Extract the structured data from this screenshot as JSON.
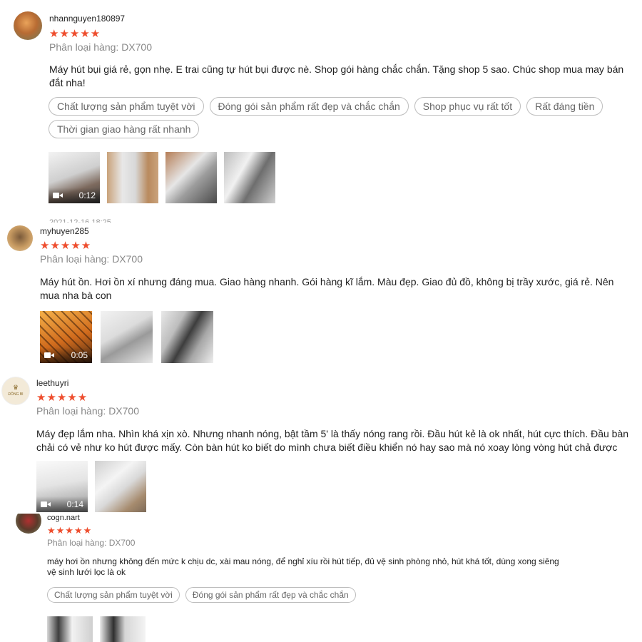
{
  "reviews": [
    {
      "username": "nhannguyen180897",
      "stars": "★★★★★",
      "variant": "Phân loại hàng: DX700",
      "text": "Máy hút bụi giá rẻ, gọn nhẹ. E trai cũng tự hút bụi được nè. Shop gói hàng chắc chắn. Tặng shop 5 sao. Chúc shop mua may bán đắt nha!",
      "tags": [
        "Chất lượng sản phẩm tuyệt vời",
        "Đóng gói sản phẩm rất đẹp và chắc chắn",
        "Shop phục vụ rất tốt",
        "Rất đáng tiền",
        "Thời gian giao hàng rất nhanh"
      ],
      "video_duration": "0:12",
      "date": "2021-12-16 18:25"
    },
    {
      "username": "myhuyen285",
      "stars": "★★★★★",
      "variant": "Phân loại hàng: DX700",
      "text": "Máy hút ồn. Hơi ồn xí nhưng đáng mua. Giao hàng nhanh. Gói hàng kĩ lắm. Màu đẹp. Giao đủ đồ, không bị trầy xước, giá rẻ. Nên mua nha bà con",
      "video_duration": "0:05"
    },
    {
      "username": "leethuyri",
      "stars": "★★★★★",
      "variant": "Phân loại hàng: DX700",
      "text": "Máy đẹp lắm nha. Nhìn khá xịn xò. Nhưng nhanh nóng, bật tầm 5' là thấy nóng rang rồi. Đầu hút kẻ là ok nhất, hút cực thích. Đầu bàn chải có vẻ như ko hút được mấy. Còn bàn hút ko biết do mình chưa biết điều khiển nó hay sao mà nó xoay lòng vòng hút chả được",
      "video_duration": "0:14",
      "avatar_text": "ĐÔNG BI"
    },
    {
      "username": "cogn.nart",
      "stars": "★★★★★",
      "variant": "Phân loại hàng: DX700",
      "text": "máy hơi ồn nhưng không đến mức k chịu dc, xài mau nóng, để nghỉ xíu rồi hút tiếp, đủ vệ sinh phòng nhỏ, hút khá tốt, dùng xong siêng vệ sinh lưới lọc là ok",
      "tags": [
        "Chất lượng sản phẩm tuyệt vời",
        "Đóng gói sản phẩm rất đẹp và chắc chắn"
      ]
    }
  ]
}
